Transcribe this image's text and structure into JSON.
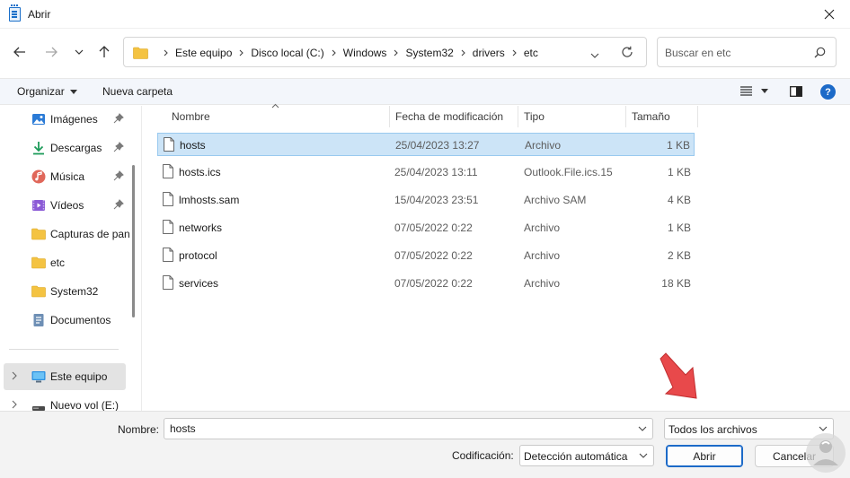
{
  "window": {
    "title": "Abrir"
  },
  "address": {
    "breadcrumbs": [
      "Este equipo",
      "Disco local (C:)",
      "Windows",
      "System32",
      "drivers",
      "etc"
    ]
  },
  "search": {
    "placeholder": "Buscar en etc"
  },
  "toolbar": {
    "organize_label": "Organizar",
    "new_folder_label": "Nueva carpeta"
  },
  "sidebar": {
    "items": [
      {
        "label": "Imágenes",
        "icon": "pictures-icon",
        "pinned": true
      },
      {
        "label": "Descargas",
        "icon": "downloads-icon",
        "pinned": true
      },
      {
        "label": "Música",
        "icon": "music-icon",
        "pinned": true
      },
      {
        "label": "Vídeos",
        "icon": "videos-icon",
        "pinned": true
      },
      {
        "label": "Capturas de pantalla",
        "icon": "folder-icon",
        "pinned": false
      },
      {
        "label": "etc",
        "icon": "folder-icon",
        "pinned": false
      },
      {
        "label": "System32",
        "icon": "folder-icon",
        "pinned": false
      },
      {
        "label": "Documentos",
        "icon": "documents-icon",
        "pinned": false
      }
    ],
    "drives": [
      {
        "label": "Este equipo",
        "icon": "computer-icon",
        "selected": true
      },
      {
        "label": "Nuevo vol (E:)",
        "icon": "drive-icon",
        "selected": false
      }
    ]
  },
  "filelist": {
    "columns": [
      "Nombre",
      "Fecha de modificación",
      "Tipo",
      "Tamaño"
    ],
    "rows": [
      {
        "name": "hosts",
        "date": "25/04/2023 13:27",
        "type": "Archivo",
        "size": "1 KB",
        "selected": true
      },
      {
        "name": "hosts.ics",
        "date": "25/04/2023 13:11",
        "type": "Outlook.File.ics.15",
        "size": "1 KB",
        "selected": false
      },
      {
        "name": "lmhosts.sam",
        "date": "15/04/2023 23:51",
        "type": "Archivo SAM",
        "size": "4 KB",
        "selected": false
      },
      {
        "name": "networks",
        "date": "07/05/2022 0:22",
        "type": "Archivo",
        "size": "1 KB",
        "selected": false
      },
      {
        "name": "protocol",
        "date": "07/05/2022 0:22",
        "type": "Archivo",
        "size": "2 KB",
        "selected": false
      },
      {
        "name": "services",
        "date": "07/05/2022 0:22",
        "type": "Archivo",
        "size": "18 KB",
        "selected": false
      }
    ]
  },
  "bottom": {
    "filename_label": "Nombre:",
    "filename_value": "hosts",
    "filter_value": "Todos los archivos",
    "encoding_label": "Codificación:",
    "encoding_value": "Detección automática",
    "open_label": "Abrir",
    "cancel_label": "Cancelar"
  },
  "colors": {
    "accent": "#1c6ac8",
    "selection": "#cce4f7",
    "folder": "#f4c342",
    "arrow": "#e8494b"
  }
}
